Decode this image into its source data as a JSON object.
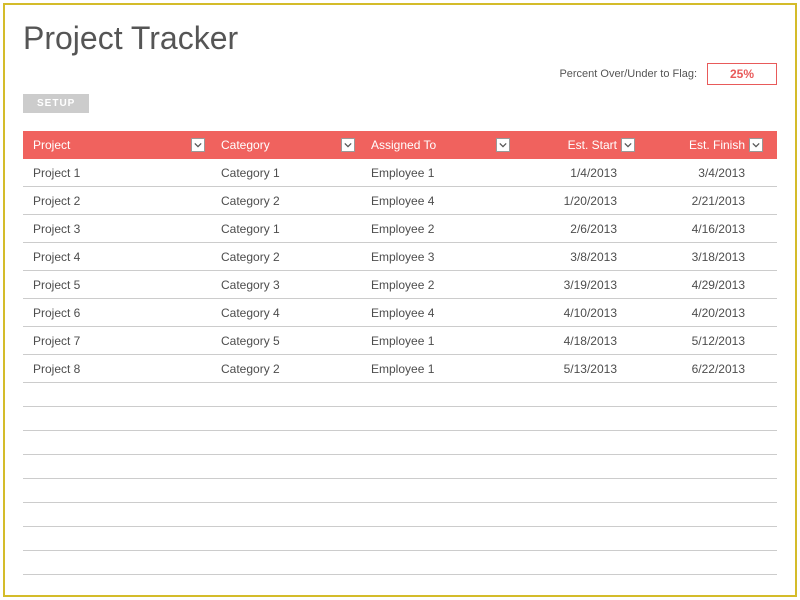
{
  "title": "Project Tracker",
  "flag": {
    "label": "Percent Over/Under to Flag:",
    "value": "25%"
  },
  "setup_button": "SETUP",
  "columns": {
    "project": "Project",
    "category": "Category",
    "assigned": "Assigned To",
    "est_start": "Est. Start",
    "est_finish": "Est. Finish"
  },
  "rows": [
    {
      "project": "Project 1",
      "category": "Category 1",
      "assigned": "Employee 1",
      "est_start": "1/4/2013",
      "est_finish": "3/4/2013"
    },
    {
      "project": "Project 2",
      "category": "Category 2",
      "assigned": "Employee 4",
      "est_start": "1/20/2013",
      "est_finish": "2/21/2013"
    },
    {
      "project": "Project 3",
      "category": "Category 1",
      "assigned": "Employee 2",
      "est_start": "2/6/2013",
      "est_finish": "4/16/2013"
    },
    {
      "project": "Project 4",
      "category": "Category 2",
      "assigned": "Employee 3",
      "est_start": "3/8/2013",
      "est_finish": "3/18/2013"
    },
    {
      "project": "Project 5",
      "category": "Category 3",
      "assigned": "Employee 2",
      "est_start": "3/19/2013",
      "est_finish": "4/29/2013"
    },
    {
      "project": "Project 6",
      "category": "Category 4",
      "assigned": "Employee 4",
      "est_start": "4/10/2013",
      "est_finish": "4/20/2013"
    },
    {
      "project": "Project 7",
      "category": "Category 5",
      "assigned": "Employee 1",
      "est_start": "4/18/2013",
      "est_finish": "5/12/2013"
    },
    {
      "project": "Project 8",
      "category": "Category 2",
      "assigned": "Employee 1",
      "est_start": "5/13/2013",
      "est_finish": "6/22/2013"
    }
  ],
  "empty_rows_count": 8
}
